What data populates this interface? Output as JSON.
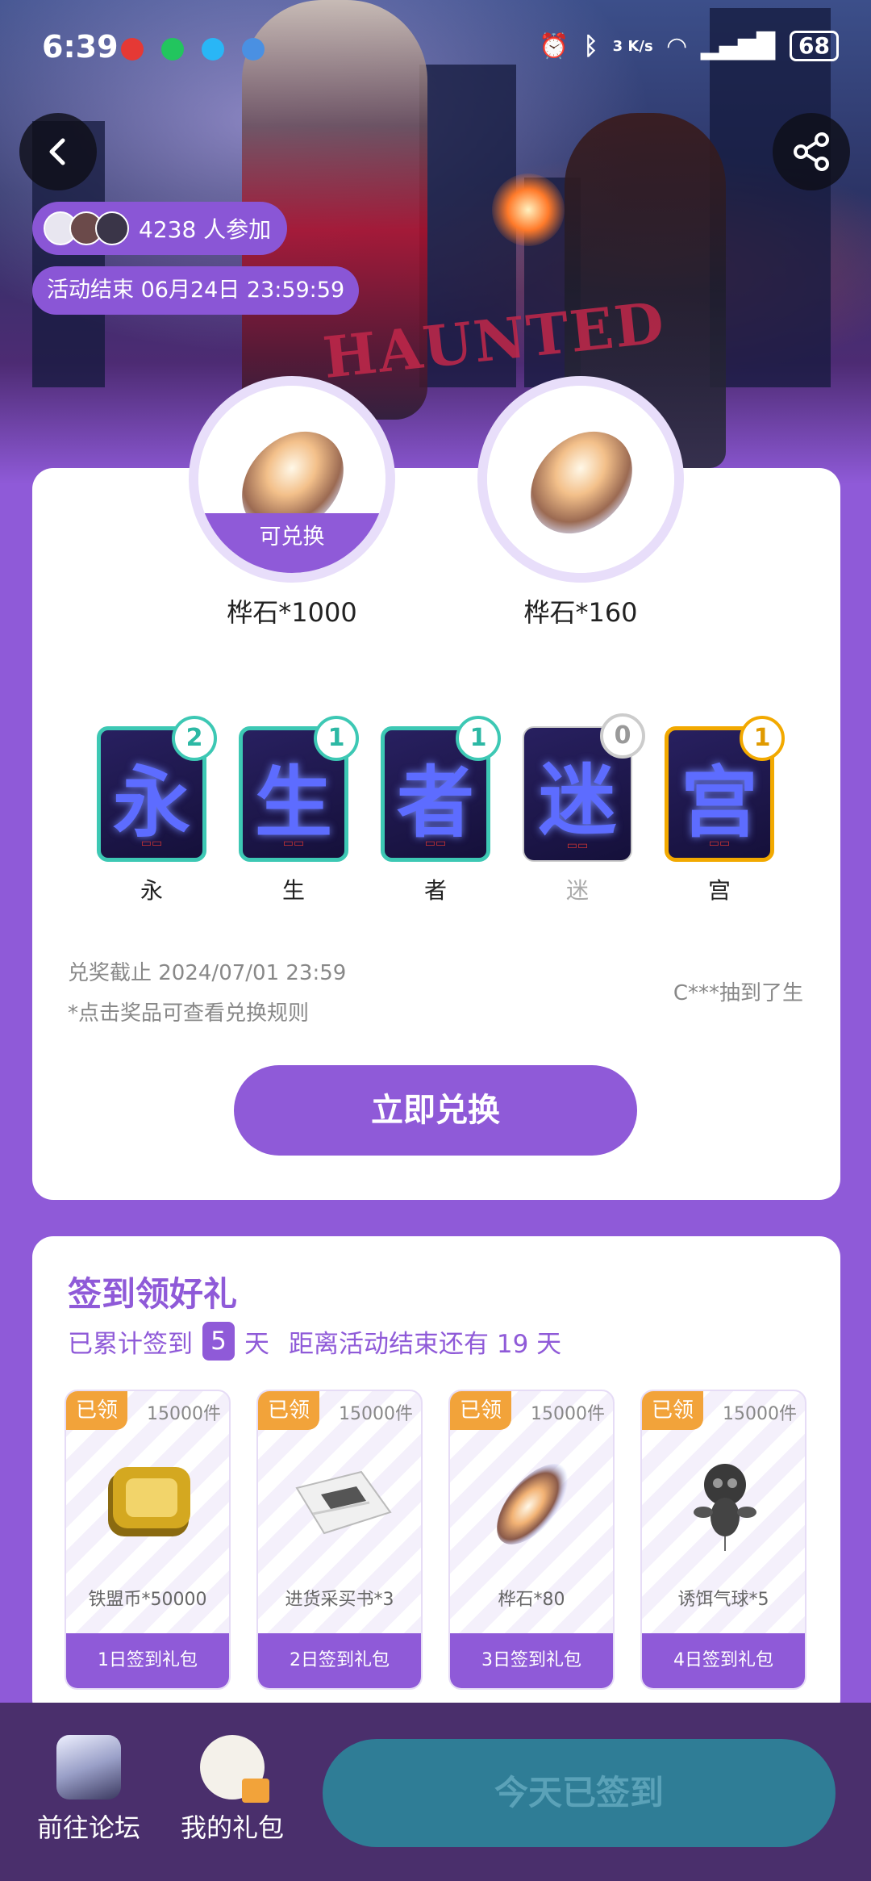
{
  "status_bar": {
    "time": "6:39",
    "speed": "3 K/s",
    "battery": "68"
  },
  "hero": {
    "participants_text": "4238 人参加",
    "event_end": "活动结束 06月24日 23:59:59",
    "logo": "HAUNTED"
  },
  "exchange": {
    "prizes": [
      {
        "label": "桦石*1000",
        "badge": "可兑换"
      },
      {
        "label": "桦石*160",
        "badge": ""
      }
    ],
    "characters": [
      {
        "glyph": "永",
        "label": "永",
        "count": "2",
        "owned": true,
        "border": "#3dc8b4"
      },
      {
        "glyph": "生",
        "label": "生",
        "count": "1",
        "owned": true,
        "border": "#3dc8b4"
      },
      {
        "glyph": "者",
        "label": "者",
        "count": "1",
        "owned": true,
        "border": "#3dc8b4"
      },
      {
        "glyph": "迷",
        "label": "迷",
        "count": "0",
        "owned": false,
        "border": "#cccccc"
      },
      {
        "glyph": "宫",
        "label": "宫",
        "count": "1",
        "owned": true,
        "border": "#f2a900"
      }
    ],
    "deadline": "兑奖截止 2024/07/01 23:59",
    "rule_hint": "*点击奖品可查看兑换规则",
    "winner_ticker": "C***抽到了生",
    "exchange_button": "立即兑换"
  },
  "signin": {
    "title": "签到领好礼",
    "sub_prefix": "已累计签到",
    "days": "5",
    "sub_unit": "天",
    "sub_suffix": "距离活动结束还有 19 天",
    "gifts": [
      {
        "status": "已领",
        "stock": "15000件",
        "name": "铁盟币*50000",
        "tag": "1日签到礼包",
        "icon": "coin-icon"
      },
      {
        "status": "已领",
        "stock": "15000件",
        "name": "进货采买书*3",
        "tag": "2日签到礼包",
        "icon": "book-icon"
      },
      {
        "status": "已领",
        "stock": "15000件",
        "name": "桦石*80",
        "tag": "3日签到礼包",
        "icon": "gem-icon"
      },
      {
        "status": "已领",
        "stock": "15000件",
        "name": "诱饵气球*5",
        "tag": "4日签到礼包",
        "icon": "balloon-icon"
      }
    ]
  },
  "bottom": {
    "forum": "前往论坛",
    "my_gifts": "我的礼包",
    "signed_button": "今天已签到"
  },
  "colors": {
    "accent": "#8f5ad8",
    "badge_orange": "#f2a33a",
    "teal": "#3dc8b4",
    "signed_btn": "#2f7d96"
  }
}
